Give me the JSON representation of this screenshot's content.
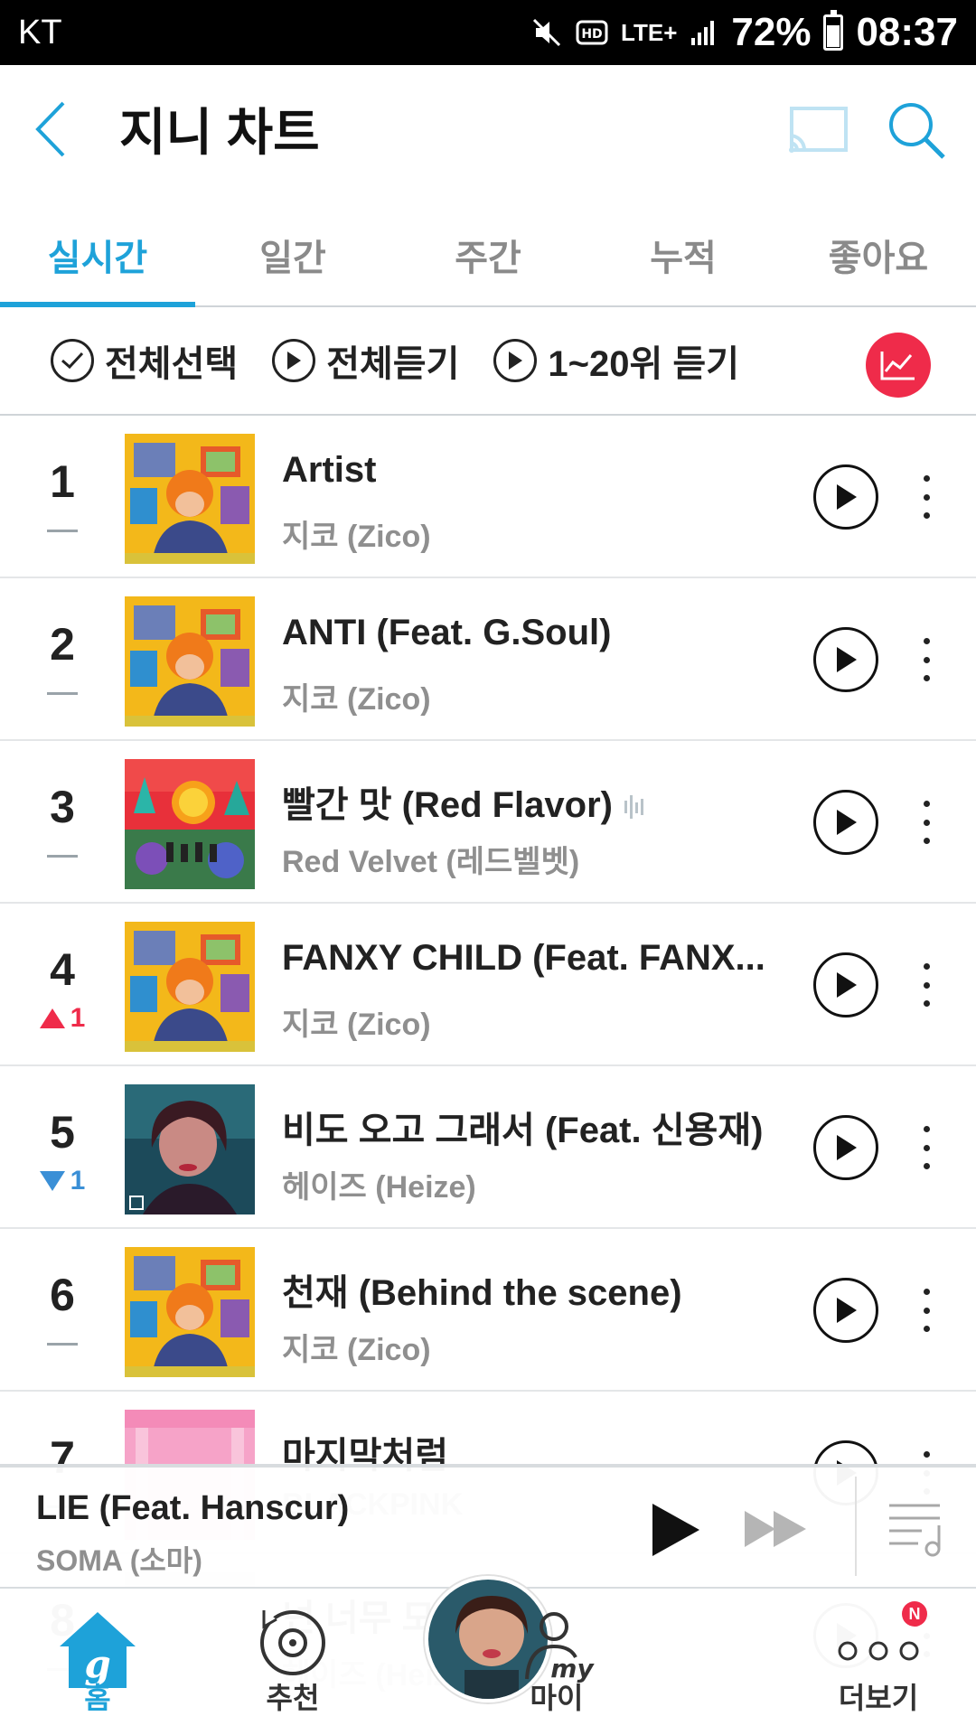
{
  "status_bar": {
    "carrier": "KT",
    "network": "LTE+",
    "battery": "72%",
    "time": "08:37"
  },
  "header": {
    "title": "지니 차트"
  },
  "tabs": [
    {
      "label": "실시간",
      "active": true
    },
    {
      "label": "일간",
      "active": false
    },
    {
      "label": "주간",
      "active": false
    },
    {
      "label": "누적",
      "active": false
    },
    {
      "label": "좋아요",
      "active": false
    }
  ],
  "actions": {
    "select_all": "전체선택",
    "play_all": "전체듣기",
    "play_top20": "1~20위 듣기"
  },
  "chart": [
    {
      "rank": "1",
      "change": "",
      "change_type": "same",
      "title": "Artist",
      "artist": "지코 (Zico)",
      "art": "zico"
    },
    {
      "rank": "2",
      "change": "",
      "change_type": "same",
      "title": "ANTI (Feat. G.Soul)",
      "artist": "지코 (Zico)",
      "art": "zico"
    },
    {
      "rank": "3",
      "change": "",
      "change_type": "same",
      "title": "빨간 맛 (Red Flavor)",
      "artist": "Red Velvet (레드벨벳)",
      "art": "redvelvet",
      "eq": true
    },
    {
      "rank": "4",
      "change": "1",
      "change_type": "up",
      "title": "FANXY CHILD (Feat. FANX...",
      "artist": "지코 (Zico)",
      "art": "zico"
    },
    {
      "rank": "5",
      "change": "1",
      "change_type": "down",
      "title": "비도 오고 그래서 (Feat. 신용재)",
      "artist": "헤이즈 (Heize)",
      "art": "heize"
    },
    {
      "rank": "6",
      "change": "",
      "change_type": "same",
      "title": "천재 (Behind the scene)",
      "artist": "지코 (Zico)",
      "art": "zico"
    },
    {
      "rank": "7",
      "change": "",
      "change_type": "same",
      "title": "마지막처럼",
      "artist": "BLACKPINK",
      "art": "pink"
    },
    {
      "rank": "8",
      "change": "",
      "change_type": "same",
      "title": "넌 너무 모르",
      "artist": "헤이즈 (Heize)",
      "art": "faded"
    }
  ],
  "now_playing": {
    "title": "LIE (Feat. Hanscur)",
    "artist": "SOMA (소마)"
  },
  "bottom_nav": {
    "home": "홈",
    "recommend": "추천",
    "my": "마이",
    "more": "더보기",
    "badge": "N"
  },
  "colors": {
    "accent": "#1ea2d9",
    "up": "#ef2b4a",
    "down": "#3a8fd6"
  }
}
